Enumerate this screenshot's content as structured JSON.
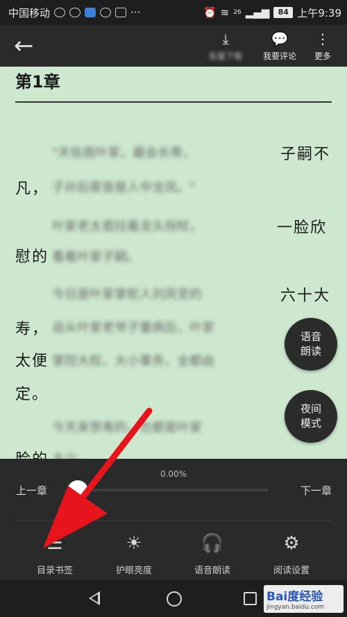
{
  "status_bar": {
    "carrier": "中国移动",
    "signal_label": "26",
    "battery": "84",
    "time": "上午9:39"
  },
  "toolbar": {
    "download_label": "批量下载",
    "comment_label": "我要评论",
    "more_label": "更多"
  },
  "reader": {
    "chapter_title": "第1章",
    "visible_fragments": [
      "子嗣不",
      "凡，",
      "一脸欣",
      "慰的",
      "六十大",
      "寿，",
      "太便",
      "定。",
      "脸的"
    ],
    "blurred_lines": [
      "\"天佑我叶家，最会长寿，",
      "子孙后辈皆是人中龙凤。\"",
      "叶家老太君拄着龙头拐杖，",
      "看着叶家子嗣。",
      "今日是叶家掌舵人刘凤至的",
      "自从叶家老爷子重病后，叶家",
      "掌控大权，大小事务，全都由",
      "今天来贺寿的，也都是叶家",
      "大小"
    ]
  },
  "fabs": {
    "voice_read": [
      "语音",
      "朗读"
    ],
    "night_mode": [
      "夜间",
      "模式"
    ]
  },
  "panel": {
    "progress_text": "0.00%",
    "progress_value": 0.0,
    "prev_chapter": "上一章",
    "next_chapter": "下一章",
    "nav": [
      {
        "label": "目录书签",
        "icon": "list-icon"
      },
      {
        "label": "护眼亮度",
        "icon": "brightness-icon"
      },
      {
        "label": "语音朗读",
        "icon": "headphones-icon"
      },
      {
        "label": "阅读设置",
        "icon": "gear-icon"
      }
    ]
  },
  "watermark": {
    "brand": "Bai度经验",
    "url": "jingyan.baidu.com"
  },
  "colors": {
    "page_bg": "#cde8cf",
    "panel_bg": "#2a2a2a",
    "arrow": "#e8141c"
  }
}
